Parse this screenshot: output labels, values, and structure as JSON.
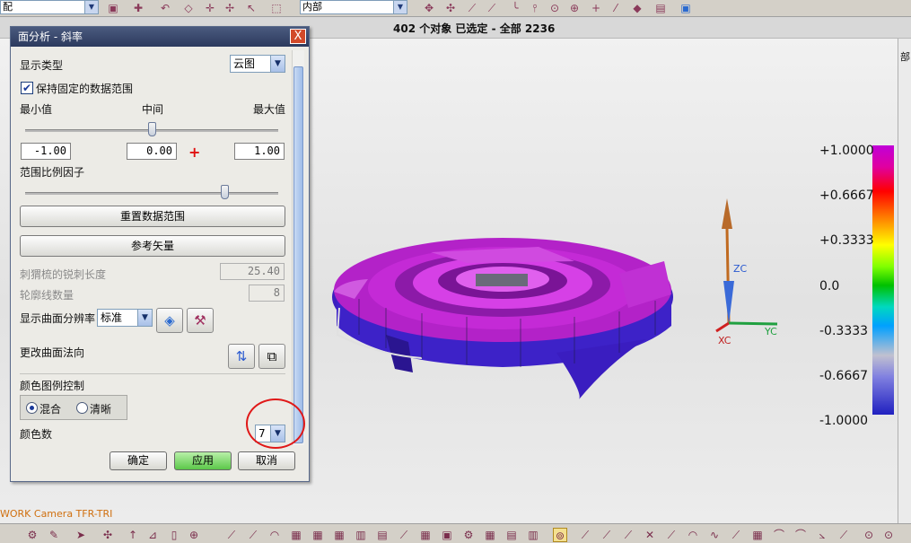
{
  "toolbar": {
    "combo1_value": "配",
    "combo2_value": "内部",
    "icons": [
      "save-icon",
      "render-style-icon",
      "undo-icon",
      "shape-icon",
      "snap-icon",
      "snap-icon",
      "snap-icon",
      "select-icon"
    ]
  },
  "status": {
    "text": "402 个对象 已选定 - 全部 2236"
  },
  "dialog": {
    "title": "面分析 - 斜率",
    "close": "X",
    "display_type_label": "显示类型",
    "display_type_value": "云图",
    "keep_range_label": "保持固定的数据范围",
    "keep_range_checked": true,
    "min_label": "最小值",
    "mid_label": "中间",
    "max_label": "最大值",
    "range_slider_position": 0.5,
    "min_value": "-1.00",
    "mid_value": "0.00",
    "max_value": "1.00",
    "cross_mark": "+",
    "scale_factor_label": "范围比例因子",
    "scale_factor_position": 0.8,
    "reset_button": "重置数据范围",
    "ref_vector_button": "参考矢量",
    "hedgehog_label": "刺猬梳的锐刺长度",
    "hedgehog_value": "25.40",
    "contour_label": "轮廓线数量",
    "contour_value": "8",
    "resolution_label": "显示曲面分辨率",
    "resolution_value": "标准",
    "normal_label": "更改曲面法向",
    "legend_ctrl_label": "颜色图例控制",
    "blend_label": "混合",
    "sharp_label": "清晰",
    "blend_selected": true,
    "color_count_label": "颜色数",
    "color_count_value": "7",
    "ok_button": "确定",
    "apply_button": "应用",
    "cancel_button": "取消"
  },
  "scale": {
    "labels": [
      "+1.0000",
      "+0.6667",
      "+0.3333",
      "0.0",
      "-0.3333",
      "-0.6667",
      "-1.0000"
    ]
  },
  "axes": {
    "zc": "ZC",
    "xc": "XC",
    "yc": "YC"
  },
  "camera_text": "WORK Camera TFR-TRI",
  "right_panel_text": "部"
}
